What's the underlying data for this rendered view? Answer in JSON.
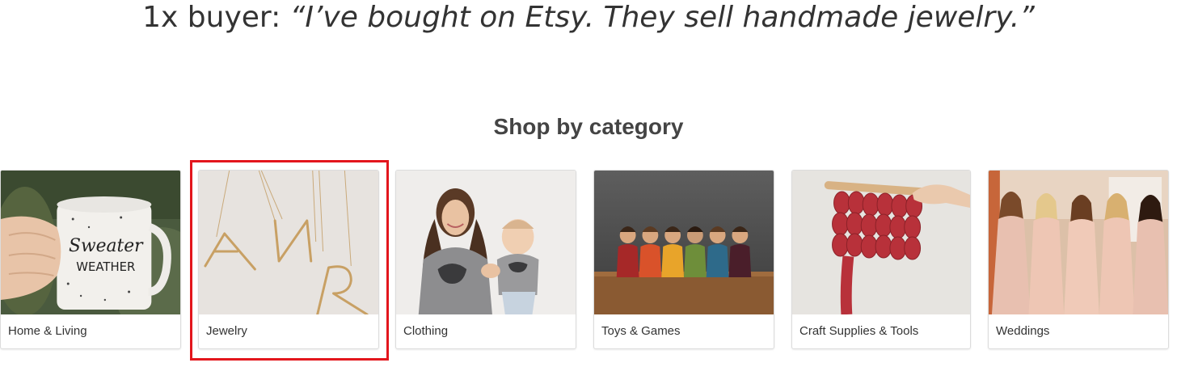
{
  "quote": {
    "prefix": "1x buyer: ",
    "text": "“I’ve bought on Etsy.  They sell handmade jewelry.”"
  },
  "section": {
    "title": "Shop by category"
  },
  "categories": [
    {
      "label": "Home & Living",
      "image": "sweater-weather-mug-image"
    },
    {
      "label": "Jewelry",
      "image": "letter-necklaces-image"
    },
    {
      "label": "Clothing",
      "image": "mom-and-baby-tshirts-image"
    },
    {
      "label": "Toys & Games",
      "image": "wooden-peg-dolls-image"
    },
    {
      "label": "Craft Supplies & Tools",
      "image": "chunky-knit-yarn-image"
    },
    {
      "label": "Weddings",
      "image": "bridesmaids-robes-image"
    }
  ],
  "mug_text": {
    "line1": "Sweater",
    "line2": "WEATHER"
  },
  "colors": {
    "highlight": "#e3161d",
    "text": "#333333",
    "card_border": "#dcdcdc"
  }
}
